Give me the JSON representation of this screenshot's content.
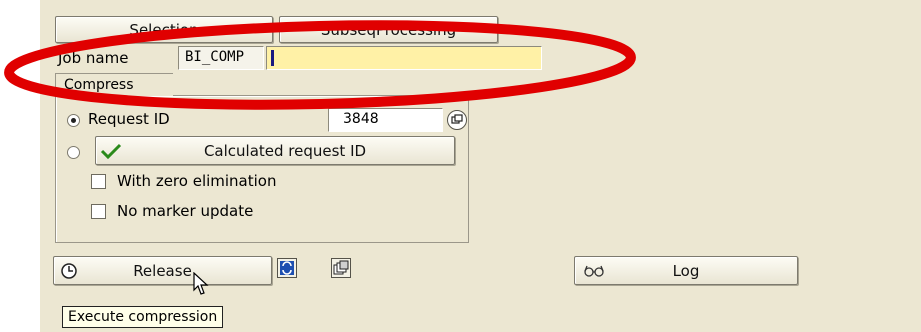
{
  "tabs": [
    {
      "label": "Selection"
    },
    {
      "label": "SubseqProcessing"
    }
  ],
  "job": {
    "label": "Job name",
    "value": "BI_COMP"
  },
  "group": {
    "title": "Compress"
  },
  "request": {
    "label": "Request ID",
    "value": "3848",
    "selected": true
  },
  "calculated": {
    "label": "Calculated request ID"
  },
  "checkboxes": [
    {
      "label": "With zero elimination",
      "checked": false
    },
    {
      "label": "No marker update",
      "checked": false
    }
  ],
  "toolbar": {
    "release_label": "Release",
    "log_label": "Log"
  },
  "tooltip": {
    "text": "Execute compression"
  },
  "colors": {
    "background": "#ece7d2",
    "input_highlight": "#fff1a6",
    "annotation": "#e00000"
  }
}
